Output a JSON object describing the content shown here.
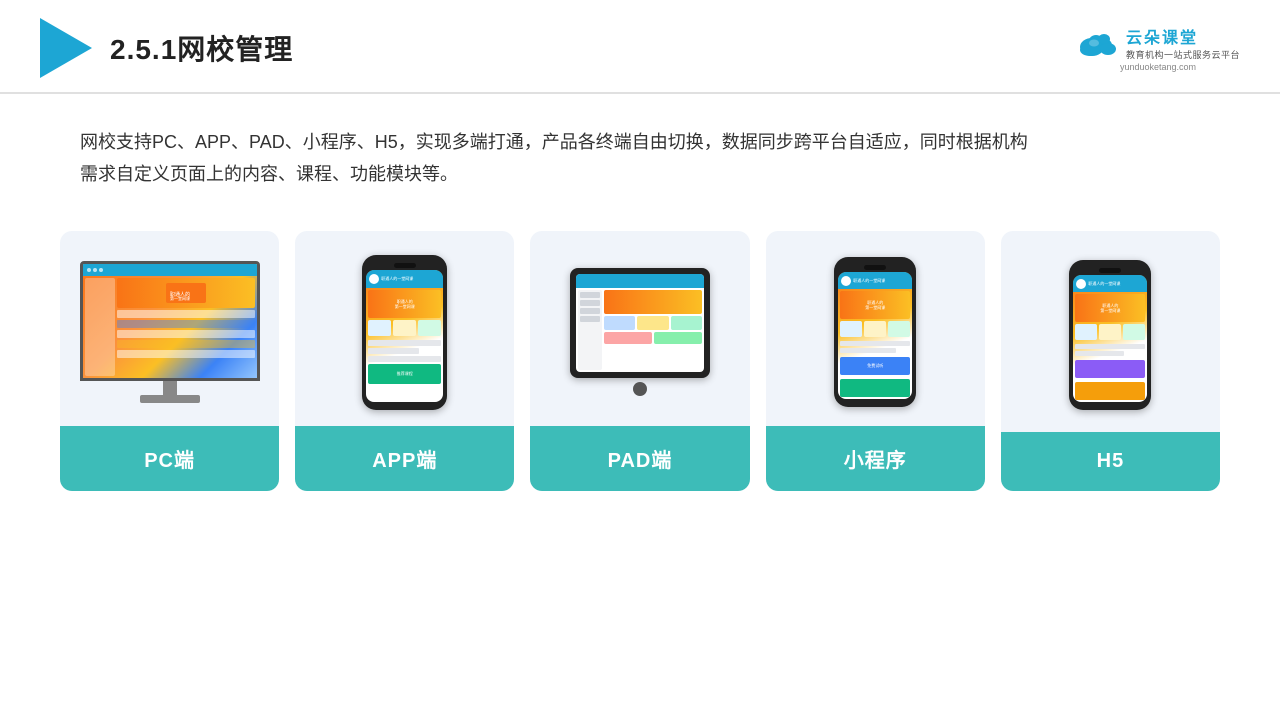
{
  "header": {
    "title": "2.5.1网校管理",
    "brand": {
      "name": "云朵课堂",
      "tagline": "教育机构一站\n式服务云平台",
      "domain": "yunduoketang.com"
    }
  },
  "description": {
    "text": "网校支持PC、APP、PAD、小程序、H5，实现多端打通，产品各终端自由切换，数据同步跨平台自适应，同时根据机构需求自定义页面上的内容、课程、功能模块等。"
  },
  "cards": [
    {
      "id": "pc",
      "label": "PC端"
    },
    {
      "id": "app",
      "label": "APP端"
    },
    {
      "id": "pad",
      "label": "PAD端"
    },
    {
      "id": "miniapp",
      "label": "小程序"
    },
    {
      "id": "h5",
      "label": "H5"
    }
  ]
}
